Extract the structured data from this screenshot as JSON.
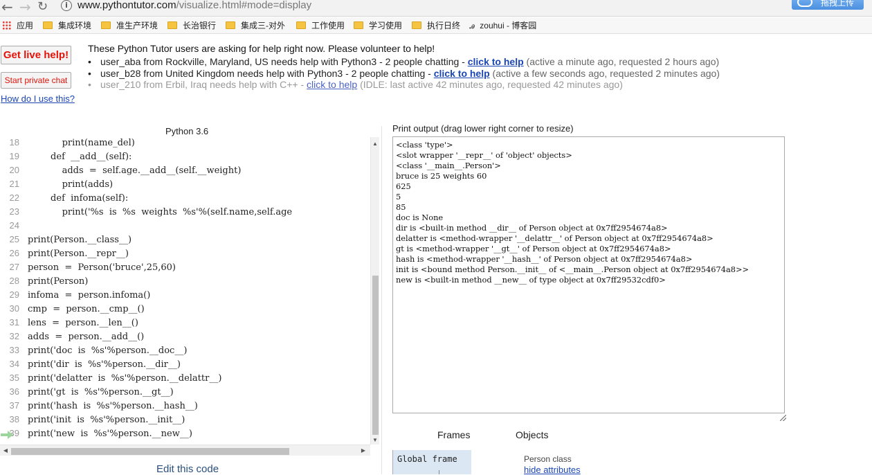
{
  "browser": {
    "url_host": "www.pythontutor.com",
    "url_path": "/visualize.html#mode=display",
    "extension_label": "拖拽上传",
    "bookmarks": [
      {
        "label": "应用",
        "type": "apps"
      },
      {
        "label": "集成环境",
        "type": "folder"
      },
      {
        "label": "准生产环境",
        "type": "folder"
      },
      {
        "label": "长治银行",
        "type": "folder"
      },
      {
        "label": "集成三-对外",
        "type": "folder"
      },
      {
        "label": "工作使用",
        "type": "folder"
      },
      {
        "label": "学习使用",
        "type": "folder"
      },
      {
        "label": "执行日终",
        "type": "folder"
      },
      {
        "label": "zouhui - 博客园",
        "type": "site"
      }
    ]
  },
  "help": {
    "live_help_button": "Get live help!",
    "private_chat_button": "Start private chat",
    "how_to_link": "How do I use this?",
    "heading": "These Python Tutor users are asking for help right now. Please volunteer to help!",
    "requests": [
      {
        "text": "user_aba from Rockville, Maryland, US needs help with Python3 - 2 people chatting - ",
        "link": "click to help",
        "meta": " (active a minute ago, requested 2 hours ago)",
        "idle": false
      },
      {
        "text": "user_b28 from United Kingdom needs help with Python3 - 2 people chatting - ",
        "link": "click to help",
        "meta": " (active a few seconds ago, requested 2 minutes ago)",
        "idle": false
      },
      {
        "text": "user_210 from Erbil, Iraq needs help with C++ - ",
        "link": "click to help",
        "meta": " (IDLE: last active 42 minutes ago, requested 42 minutes ago)",
        "idle": true
      }
    ]
  },
  "editor": {
    "language_label": "Python 3.6",
    "edit_link": "Edit this code",
    "lines": [
      {
        "num": "18",
        "code": "            print(name_del)"
      },
      {
        "num": "19",
        "code": "        def  __add__(self):"
      },
      {
        "num": "20",
        "code": "            adds  =  self.age.__add__(self.__weight)"
      },
      {
        "num": "21",
        "code": "            print(adds)"
      },
      {
        "num": "22",
        "code": "        def  infoma(self):"
      },
      {
        "num": "23",
        "code": "            print('%s  is  %s  weights  %s'%(self.name,self.age"
      },
      {
        "num": "24",
        "code": ""
      },
      {
        "num": "25",
        "code": "print(Person.__class__)"
      },
      {
        "num": "26",
        "code": "print(Person.__repr__)"
      },
      {
        "num": "27",
        "code": "person  =  Person('bruce',25,60)"
      },
      {
        "num": "28",
        "code": "print(Person)"
      },
      {
        "num": "29",
        "code": "infoma  =  person.infoma()"
      },
      {
        "num": "30",
        "code": "cmp  =  person.__cmp__()"
      },
      {
        "num": "31",
        "code": "lens  =  person.__len__()"
      },
      {
        "num": "32",
        "code": "adds  =  person.__add__()"
      },
      {
        "num": "33",
        "code": "print('doc  is  %s'%person.__doc__)"
      },
      {
        "num": "34",
        "code": "print('dir  is  %s'%person.__dir__)"
      },
      {
        "num": "35",
        "code": "print('delatter  is  %s'%person.__delattr__)"
      },
      {
        "num": "36",
        "code": "print('gt  is  %s'%person.__gt__)"
      },
      {
        "num": "37",
        "code": "print('hash  is  %s'%person.__hash__)"
      },
      {
        "num": "38",
        "code": "print('init  is  %s'%person.__init__)"
      },
      {
        "num": "39",
        "code": "print('new  is  %s'%person.__new__)"
      }
    ]
  },
  "output": {
    "label": "Print output (drag lower right corner to resize)",
    "lines": [
      "<class 'type'>",
      "<slot wrapper '__repr__' of 'object' objects>",
      "<class '__main__.Person'>",
      "bruce is 25 weights 60",
      "625",
      "5",
      "85",
      "doc is None",
      "dir is <built-in method __dir__ of Person object at 0x7ff2954674a8>",
      "delatter is <method-wrapper '__delattr__' of Person object at 0x7ff2954674a8>",
      "gt is <method-wrapper '__gt__' of Person object at 0x7ff2954674a8>",
      "hash is <method-wrapper '__hash__' of Person object at 0x7ff2954674a8>",
      "init is <bound method Person.__init__ of <__main__.Person object at 0x7ff2954674a8>>",
      "new is <built-in method __new__ of type object at 0x7ff29532cdf0>"
    ]
  },
  "viz": {
    "frames_heading": "Frames",
    "objects_heading": "Objects",
    "global_frame": "Global frame",
    "object_label": "Person class",
    "hide_attributes": "hide attributes"
  },
  "colors": {
    "link": "#1a45b3",
    "live_help_red": "#e3130a",
    "frame_bg": "#dbe7f3",
    "arrow_green": "#9ed59c"
  }
}
